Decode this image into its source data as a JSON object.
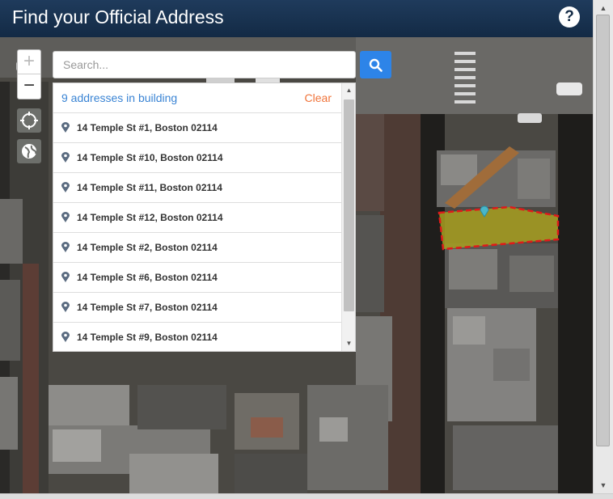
{
  "header": {
    "title": "Find your Official Address",
    "help_label": "?"
  },
  "map_controls": {
    "zoom_in": "+",
    "zoom_out": "−",
    "locate_icon": "crosshair-icon",
    "basemap_icon": "globe-icon"
  },
  "search": {
    "placeholder": "Search...",
    "value": "",
    "button_icon": "search-icon"
  },
  "results": {
    "count_label": "9 addresses in building",
    "clear_label": "Clear",
    "items": [
      "14 Temple St #1, Boston 02114",
      "14 Temple St #10, Boston 02114",
      "14 Temple St #11, Boston 02114",
      "14 Temple St #12, Boston 02114",
      "14 Temple St #2, Boston 02114",
      "14 Temple St #6, Boston 02114",
      "14 Temple St #7, Boston 02114",
      "14 Temple St #9, Boston 02114"
    ]
  },
  "colors": {
    "header_bg": "#132a45",
    "search_button": "#2d84e8",
    "count_text": "#3a84d4",
    "clear_text": "#f0743b",
    "building_highlight": "#a8a020",
    "building_outline": "#e01a1a"
  }
}
